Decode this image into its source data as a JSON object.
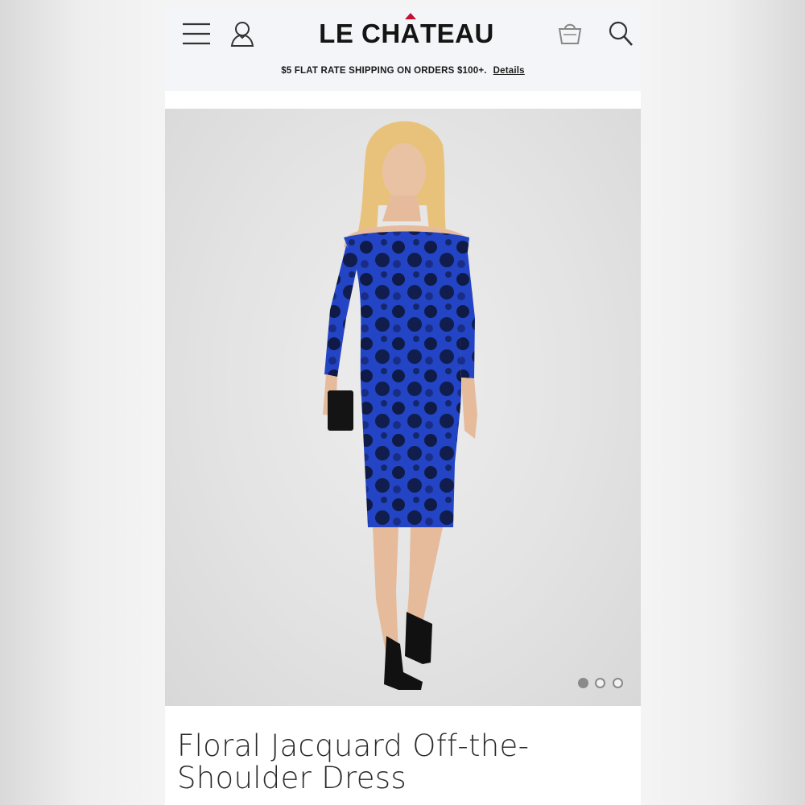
{
  "header": {
    "brand": {
      "prefix": "LE CH",
      "accent_letter": "A",
      "suffix": "TEAU",
      "accent_color": "#c8102e"
    },
    "promo_text": "$5 FLAT RATE SHIPPING ON ORDERS $100+.",
    "promo_link": "Details",
    "icons": [
      "menu-icon",
      "account-icon",
      "shopping-bag-icon",
      "search-icon"
    ]
  },
  "product": {
    "image_slides": {
      "count": 3,
      "active": 1
    },
    "title_line1": "Floral Jacquard Off-the-",
    "title_line2": "Shoulder Dress",
    "dress_color": "#1f3fb8"
  }
}
